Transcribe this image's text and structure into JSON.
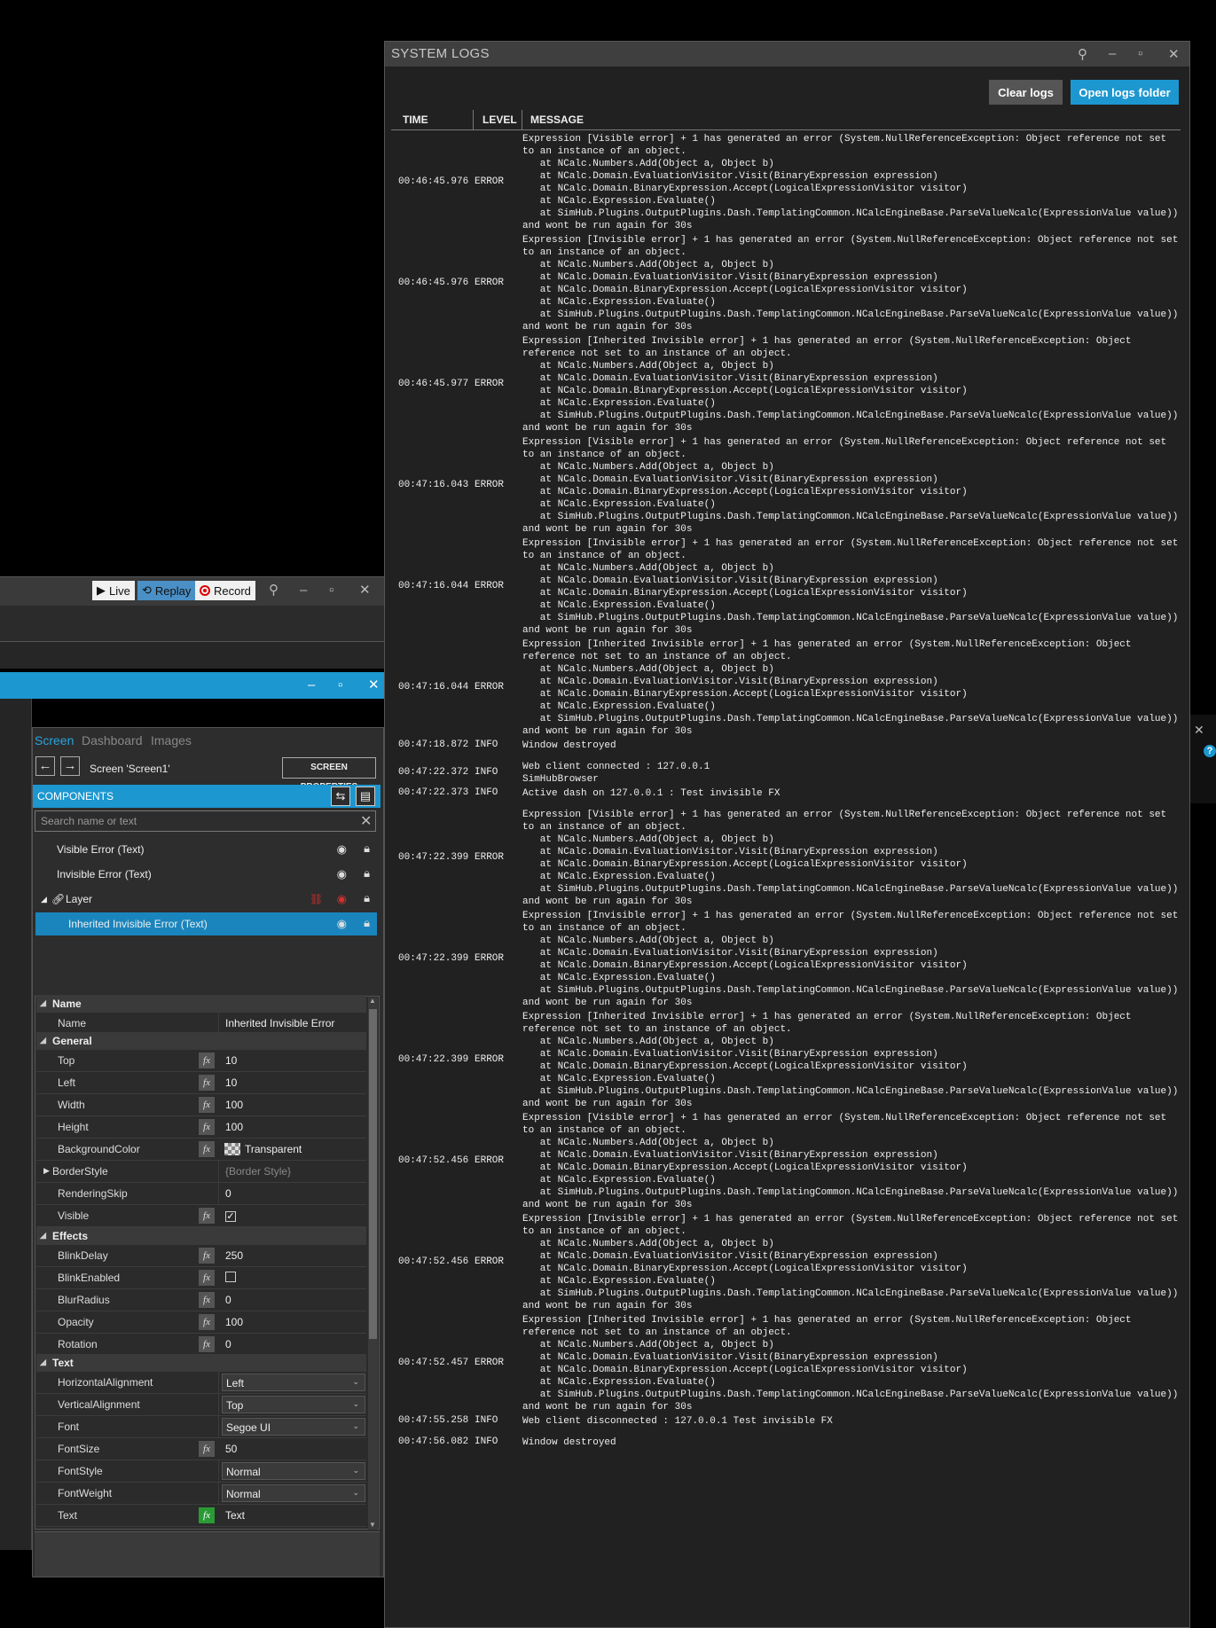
{
  "replay_toolbar": {
    "live": "Live",
    "replay": "Replay",
    "record": "Record"
  },
  "panel": {
    "tabs": [
      "Screen",
      "Dashboard",
      "Images"
    ],
    "screen_name": "Screen 'Screen1'",
    "screen_properties": "SCREEN PROPERTIES",
    "components_title": "COMPONENTS",
    "search_placeholder": "Search name or text",
    "components": [
      {
        "label": "Visible Error  (Text)"
      },
      {
        "label": "Invisible Error  (Text)"
      },
      {
        "label": "Layer"
      },
      {
        "label": "Inherited Invisible Error  (Text)"
      }
    ]
  },
  "props": {
    "cat_name": "Name",
    "cat_general": "General",
    "cat_effects": "Effects",
    "cat_text": "Text",
    "name": {
      "label": "Name",
      "value": "Inherited Invisible Error"
    },
    "top": {
      "label": "Top",
      "value": "10"
    },
    "left": {
      "label": "Left",
      "value": "10"
    },
    "width": {
      "label": "Width",
      "value": "100"
    },
    "height": {
      "label": "Height",
      "value": "100"
    },
    "background": {
      "label": "BackgroundColor",
      "value": "Transparent"
    },
    "border": {
      "label": "BorderStyle",
      "value": "{Border Style}"
    },
    "rskip": {
      "label": "RenderingSkip",
      "value": "0"
    },
    "visible": {
      "label": "Visible",
      "checked": "✓"
    },
    "blinkdelay": {
      "label": "BlinkDelay",
      "value": "250"
    },
    "blinkenabled": {
      "label": "BlinkEnabled"
    },
    "blur": {
      "label": "BlurRadius",
      "value": "0"
    },
    "opacity": {
      "label": "Opacity",
      "value": "100"
    },
    "rotation": {
      "label": "Rotation",
      "value": "0"
    },
    "halign": {
      "label": "HorizontalAlignment",
      "value": "Left"
    },
    "valign": {
      "label": "VerticalAlignment",
      "value": "Top"
    },
    "font": {
      "label": "Font",
      "value": "Segoe UI"
    },
    "fontsize": {
      "label": "FontSize",
      "value": "50"
    },
    "fontstyle": {
      "label": "FontStyle",
      "value": "Normal"
    },
    "fontweight": {
      "label": "FontWeight",
      "value": "Normal"
    },
    "text": {
      "label": "Text",
      "value": "Text"
    },
    "fx": "fx"
  },
  "logs": {
    "title": "SYSTEM LOGS",
    "clear": "Clear logs",
    "open": "Open logs folder",
    "col_time": "TIME",
    "col_level": "LEVEL",
    "col_message": "MESSAGE",
    "rows": [
      {
        "time": "00:46:45.976",
        "level": "ERROR",
        "msg": "Expression [Visible error] + 1 has generated an error (System.NullReferenceException: Object reference not set\nto an instance of an object.\n   at NCalc.Numbers.Add(Object a, Object b)\n   at NCalc.Domain.EvaluationVisitor.Visit(BinaryExpression expression)\n   at NCalc.Domain.BinaryExpression.Accept(LogicalExpressionVisitor visitor)\n   at NCalc.Expression.Evaluate()\n   at SimHub.Plugins.OutputPlugins.Dash.TemplatingCommon.NCalcEngineBase.ParseValueNcalc(ExpressionValue value))\nand wont be run again for 30s"
      },
      {
        "time": "00:46:45.976",
        "level": "ERROR",
        "msg": "Expression [Invisible error] + 1 has generated an error (System.NullReferenceException: Object reference not set\nto an instance of an object.\n   at NCalc.Numbers.Add(Object a, Object b)\n   at NCalc.Domain.EvaluationVisitor.Visit(BinaryExpression expression)\n   at NCalc.Domain.BinaryExpression.Accept(LogicalExpressionVisitor visitor)\n   at NCalc.Expression.Evaluate()\n   at SimHub.Plugins.OutputPlugins.Dash.TemplatingCommon.NCalcEngineBase.ParseValueNcalc(ExpressionValue value))\nand wont be run again for 30s"
      },
      {
        "time": "00:46:45.977",
        "level": "ERROR",
        "msg": "Expression [Inherited Invisible error] + 1 has generated an error (System.NullReferenceException: Object\nreference not set to an instance of an object.\n   at NCalc.Numbers.Add(Object a, Object b)\n   at NCalc.Domain.EvaluationVisitor.Visit(BinaryExpression expression)\n   at NCalc.Domain.BinaryExpression.Accept(LogicalExpressionVisitor visitor)\n   at NCalc.Expression.Evaluate()\n   at SimHub.Plugins.OutputPlugins.Dash.TemplatingCommon.NCalcEngineBase.ParseValueNcalc(ExpressionValue value))\nand wont be run again for 30s"
      },
      {
        "time": "00:47:16.043",
        "level": "ERROR",
        "msg": "Expression [Visible error] + 1 has generated an error (System.NullReferenceException: Object reference not set\nto an instance of an object.\n   at NCalc.Numbers.Add(Object a, Object b)\n   at NCalc.Domain.EvaluationVisitor.Visit(BinaryExpression expression)\n   at NCalc.Domain.BinaryExpression.Accept(LogicalExpressionVisitor visitor)\n   at NCalc.Expression.Evaluate()\n   at SimHub.Plugins.OutputPlugins.Dash.TemplatingCommon.NCalcEngineBase.ParseValueNcalc(ExpressionValue value))\nand wont be run again for 30s"
      },
      {
        "time": "00:47:16.044",
        "level": "ERROR",
        "msg": "Expression [Invisible error] + 1 has generated an error (System.NullReferenceException: Object reference not set\nto an instance of an object.\n   at NCalc.Numbers.Add(Object a, Object b)\n   at NCalc.Domain.EvaluationVisitor.Visit(BinaryExpression expression)\n   at NCalc.Domain.BinaryExpression.Accept(LogicalExpressionVisitor visitor)\n   at NCalc.Expression.Evaluate()\n   at SimHub.Plugins.OutputPlugins.Dash.TemplatingCommon.NCalcEngineBase.ParseValueNcalc(ExpressionValue value))\nand wont be run again for 30s"
      },
      {
        "time": "00:47:16.044",
        "level": "ERROR",
        "msg": "Expression [Inherited Invisible error] + 1 has generated an error (System.NullReferenceException: Object\nreference not set to an instance of an object.\n   at NCalc.Numbers.Add(Object a, Object b)\n   at NCalc.Domain.EvaluationVisitor.Visit(BinaryExpression expression)\n   at NCalc.Domain.BinaryExpression.Accept(LogicalExpressionVisitor visitor)\n   at NCalc.Expression.Evaluate()\n   at SimHub.Plugins.OutputPlugins.Dash.TemplatingCommon.NCalcEngineBase.ParseValueNcalc(ExpressionValue value))\nand wont be run again for 30s"
      },
      {
        "time": "00:47:18.872",
        "level": "INFO",
        "msg": "Window destroyed"
      },
      {
        "time": "00:47:22.372",
        "level": "INFO",
        "msg": "Web client connected : 127.0.0.1\nSimHubBrowser"
      },
      {
        "time": "00:47:22.373",
        "level": "INFO",
        "msg": "Active dash on 127.0.0.1 : Test invisible FX"
      },
      {
        "time": "00:47:22.399",
        "level": "ERROR",
        "msg": "Expression [Visible error] + 1 has generated an error (System.NullReferenceException: Object reference not set\nto an instance of an object.\n   at NCalc.Numbers.Add(Object a, Object b)\n   at NCalc.Domain.EvaluationVisitor.Visit(BinaryExpression expression)\n   at NCalc.Domain.BinaryExpression.Accept(LogicalExpressionVisitor visitor)\n   at NCalc.Expression.Evaluate()\n   at SimHub.Plugins.OutputPlugins.Dash.TemplatingCommon.NCalcEngineBase.ParseValueNcalc(ExpressionValue value))\nand wont be run again for 30s"
      },
      {
        "time": "00:47:22.399",
        "level": "ERROR",
        "msg": "Expression [Invisible error] + 1 has generated an error (System.NullReferenceException: Object reference not set\nto an instance of an object.\n   at NCalc.Numbers.Add(Object a, Object b)\n   at NCalc.Domain.EvaluationVisitor.Visit(BinaryExpression expression)\n   at NCalc.Domain.BinaryExpression.Accept(LogicalExpressionVisitor visitor)\n   at NCalc.Expression.Evaluate()\n   at SimHub.Plugins.OutputPlugins.Dash.TemplatingCommon.NCalcEngineBase.ParseValueNcalc(ExpressionValue value))\nand wont be run again for 30s"
      },
      {
        "time": "00:47:22.399",
        "level": "ERROR",
        "msg": "Expression [Inherited Invisible error] + 1 has generated an error (System.NullReferenceException: Object\nreference not set to an instance of an object.\n   at NCalc.Numbers.Add(Object a, Object b)\n   at NCalc.Domain.EvaluationVisitor.Visit(BinaryExpression expression)\n   at NCalc.Domain.BinaryExpression.Accept(LogicalExpressionVisitor visitor)\n   at NCalc.Expression.Evaluate()\n   at SimHub.Plugins.OutputPlugins.Dash.TemplatingCommon.NCalcEngineBase.ParseValueNcalc(ExpressionValue value))\nand wont be run again for 30s"
      },
      {
        "time": "00:47:52.456",
        "level": "ERROR",
        "msg": "Expression [Visible error] + 1 has generated an error (System.NullReferenceException: Object reference not set\nto an instance of an object.\n   at NCalc.Numbers.Add(Object a, Object b)\n   at NCalc.Domain.EvaluationVisitor.Visit(BinaryExpression expression)\n   at NCalc.Domain.BinaryExpression.Accept(LogicalExpressionVisitor visitor)\n   at NCalc.Expression.Evaluate()\n   at SimHub.Plugins.OutputPlugins.Dash.TemplatingCommon.NCalcEngineBase.ParseValueNcalc(ExpressionValue value))\nand wont be run again for 30s"
      },
      {
        "time": "00:47:52.456",
        "level": "ERROR",
        "msg": "Expression [Invisible error] + 1 has generated an error (System.NullReferenceException: Object reference not set\nto an instance of an object.\n   at NCalc.Numbers.Add(Object a, Object b)\n   at NCalc.Domain.EvaluationVisitor.Visit(BinaryExpression expression)\n   at NCalc.Domain.BinaryExpression.Accept(LogicalExpressionVisitor visitor)\n   at NCalc.Expression.Evaluate()\n   at SimHub.Plugins.OutputPlugins.Dash.TemplatingCommon.NCalcEngineBase.ParseValueNcalc(ExpressionValue value))\nand wont be run again for 30s"
      },
      {
        "time": "00:47:52.457",
        "level": "ERROR",
        "msg": "Expression [Inherited Invisible error] + 1 has generated an error (System.NullReferenceException: Object\nreference not set to an instance of an object.\n   at NCalc.Numbers.Add(Object a, Object b)\n   at NCalc.Domain.EvaluationVisitor.Visit(BinaryExpression expression)\n   at NCalc.Domain.BinaryExpression.Accept(LogicalExpressionVisitor visitor)\n   at NCalc.Expression.Evaluate()\n   at SimHub.Plugins.OutputPlugins.Dash.TemplatingCommon.NCalcEngineBase.ParseValueNcalc(ExpressionValue value))\nand wont be run again for 30s"
      },
      {
        "time": "00:47:55.258",
        "level": "INFO",
        "msg": "Web client disconnected : 127.0.0.1 Test invisible FX"
      },
      {
        "time": "00:47:56.082",
        "level": "INFO",
        "msg": "Window destroyed"
      }
    ]
  }
}
